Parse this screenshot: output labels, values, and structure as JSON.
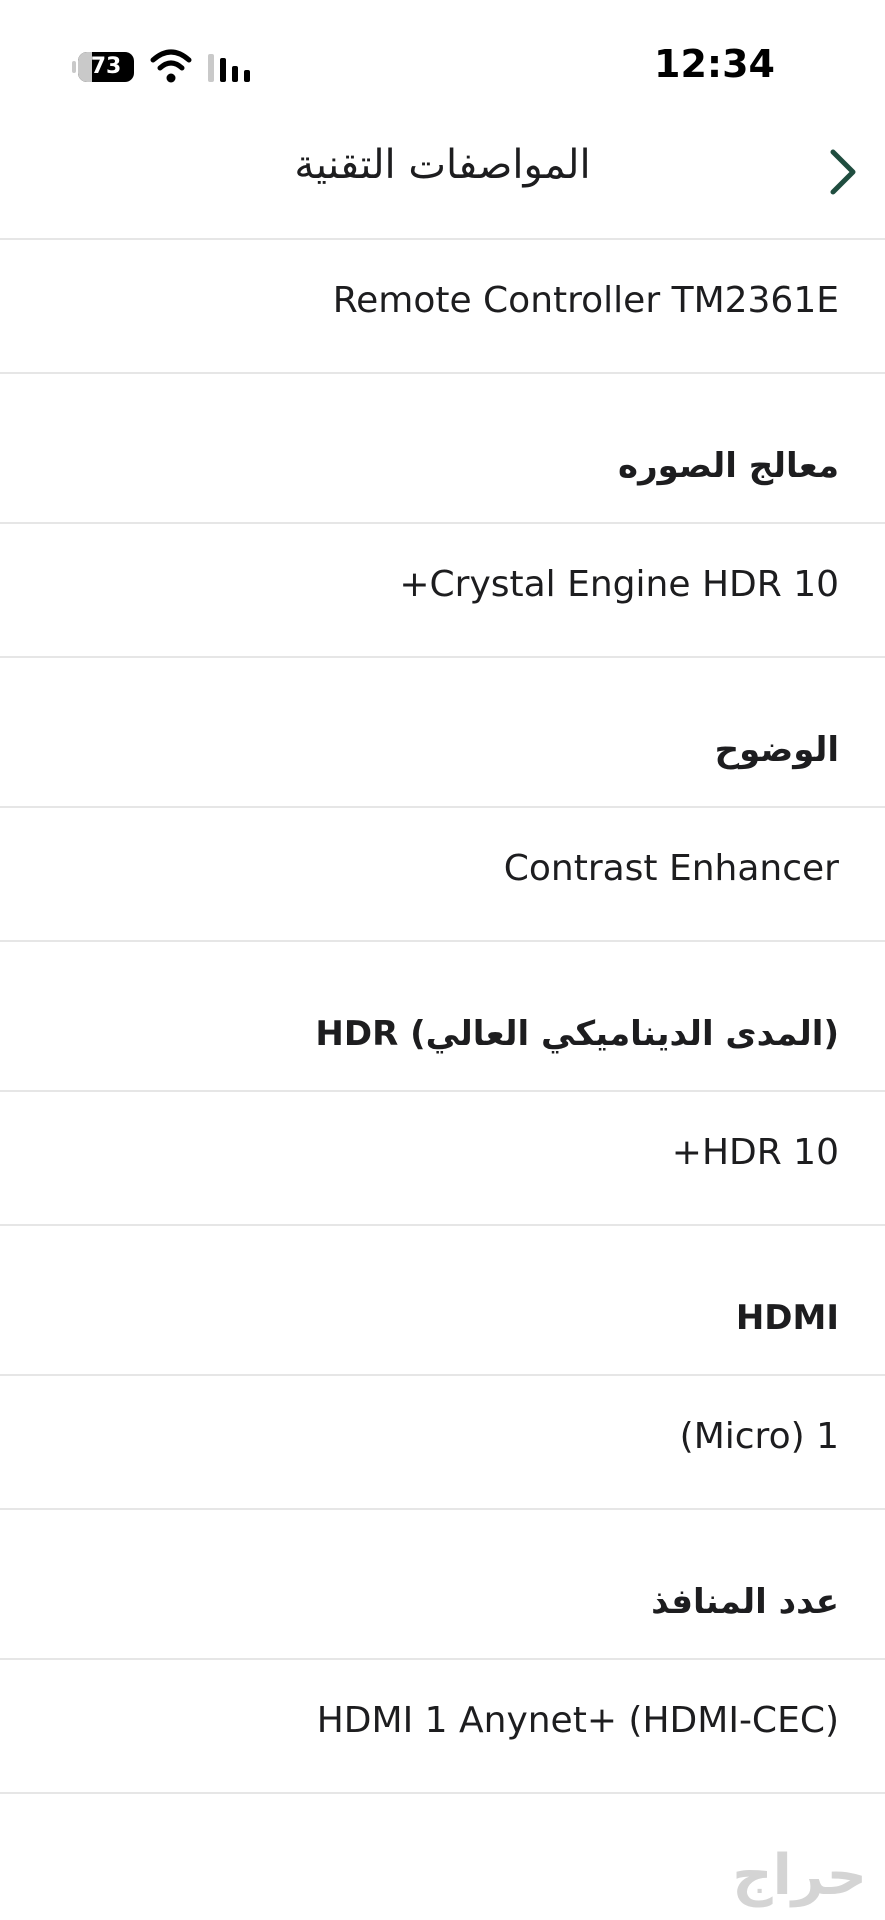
{
  "status_bar": {
    "battery_level": "73",
    "time": "12:34"
  },
  "header": {
    "title": "المواصفات التقنية",
    "back_icon": "chevron-right-icon"
  },
  "specs": {
    "remote_value": "Remote Controller TM2361E",
    "processor_label": "معالج الصوره",
    "processor_value": "Crystal Engine HDR 10+",
    "clarity_label": "الوضوح",
    "clarity_value": "Contrast Enhancer",
    "hdr_label": "(المدى الديناميكي العالي) HDR",
    "hdr_value": "HDR 10+",
    "hdmi_label": "HDMI",
    "hdmi_value": "1 (Micro)",
    "ports_label": "عدد المنافذ",
    "ports_value": "HDMI 1 Anynet+ (HDMI-CEC)"
  },
  "watermark": "حراج"
}
